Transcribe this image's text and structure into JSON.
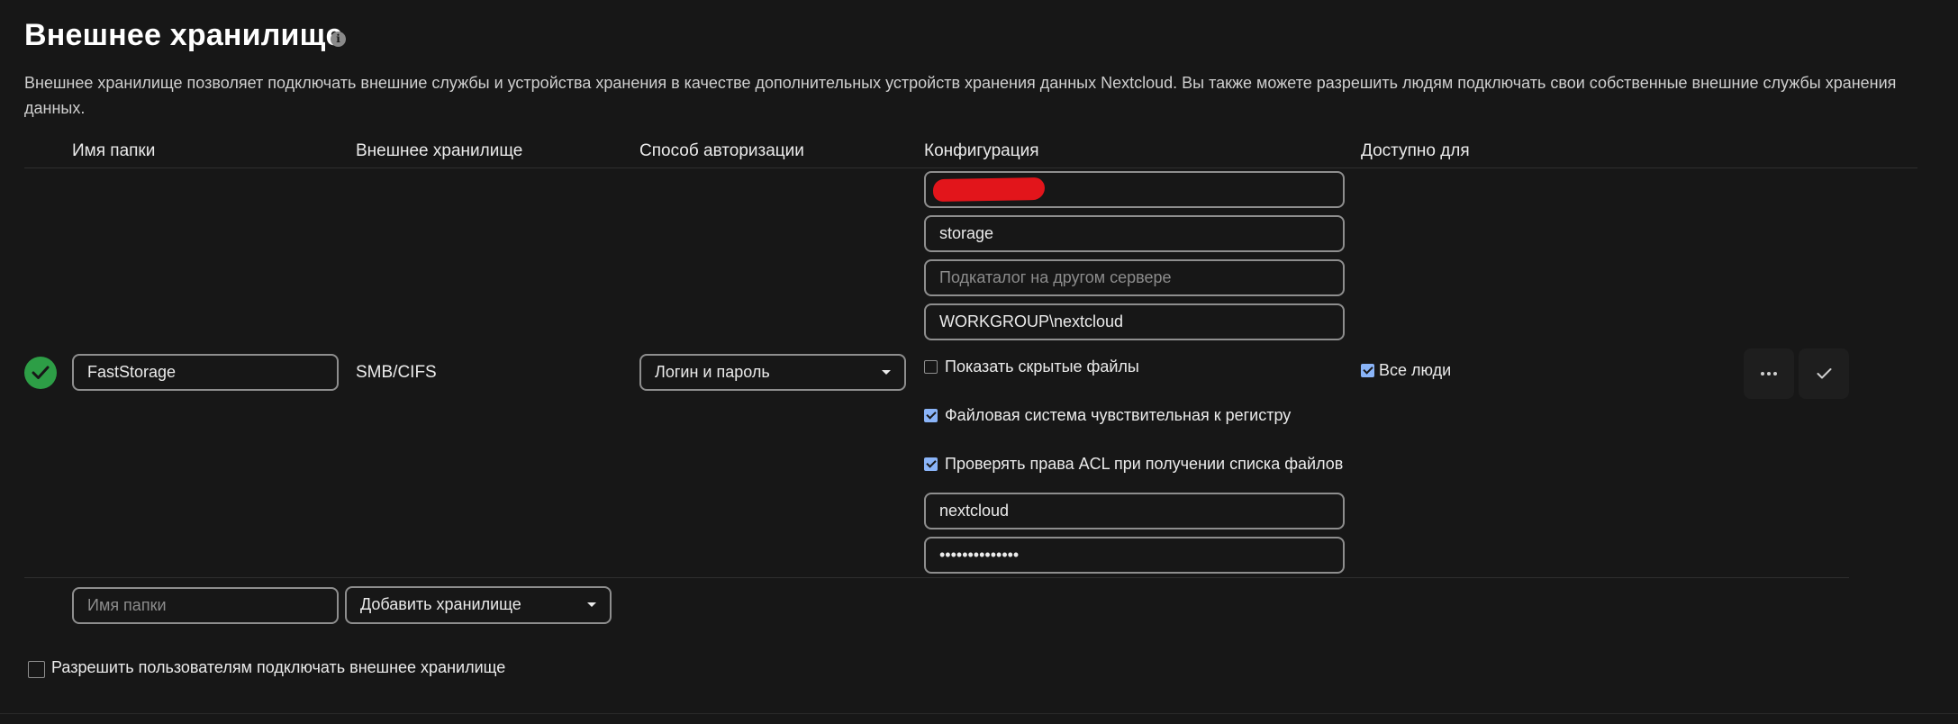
{
  "page": {
    "title": "Внешнее хранилище",
    "description": "Внешнее хранилище позволяет подключать внешние службы и устройства хранения в качестве дополнительных устройств хранения данных Nextcloud. Вы также можете разрешить людям подключать свои собственные внешние службы хранения данных."
  },
  "table": {
    "headers": {
      "folder_name": "Имя папки",
      "external_storage": "Внешнее хранилище",
      "auth_method": "Способ авторизации",
      "configuration": "Конфигурация",
      "available_for": "Доступно для"
    },
    "mount": {
      "status": "ok",
      "folder_name": "FastStorage",
      "backend": "SMB/CIFS",
      "auth_method": "Логин и пароль",
      "config": {
        "share": "storage",
        "subfolder_placeholder": "Подкаталог на другом сервере",
        "domain": "WORKGROUP\\nextcloud",
        "show_hidden_label": "Показать скрытые файлы",
        "show_hidden": false,
        "case_sensitive_label": "Файловая система чувствительная к регистру",
        "case_sensitive": true,
        "check_acl_label": "Проверять права ACL при получении списка файлов",
        "check_acl": true,
        "login": "nextcloud",
        "password": "••••••••••••••"
      },
      "available_for_label": "Все люди",
      "available_for_all": true
    },
    "new_mount": {
      "folder_placeholder": "Имя папки",
      "add_storage_label": "Добавить хранилище"
    }
  },
  "allow_user_mounting": {
    "label": "Разрешить пользователям подключать внешнее хранилище",
    "checked": false
  },
  "colors": {
    "background": "#171717",
    "status_ok": "#2d9e46",
    "checkbox_checked": "#8ab4f8"
  },
  "icons": [
    "info-icon",
    "check-circle-icon",
    "more-dots-icon",
    "checkmark-icon",
    "chevron-down-icon"
  ]
}
